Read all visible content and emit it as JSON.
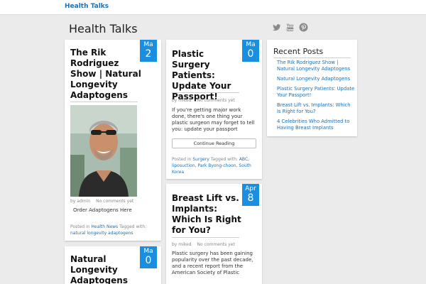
{
  "topbar": {
    "brand": "Health Talks"
  },
  "site": {
    "title": "Health Talks"
  },
  "social": {
    "icons": [
      "twitter-icon",
      "youtube-icon",
      "pinterest-icon"
    ],
    "color": "#8a8a8a"
  },
  "accent": "#1a8fe0",
  "posts": [
    {
      "date_month": "Ma",
      "date_day": "2",
      "title": "The Rik Rodriguez Show | Natural Longevity Adaptogens",
      "author": "by admin",
      "comments": "No comments yet",
      "excerpt": "Order Adaptogens Here",
      "posted_in_label": "Posted in",
      "category": "Health News",
      "tagged_label": "Tagged with:",
      "tags": "natural longevity adaptogens"
    },
    {
      "date_month": "Ma",
      "date_day": "0",
      "title": "Plastic Surgery Patients: Update Your Passport!",
      "author": "by miked",
      "comments": "No comments yet",
      "excerpt": "If you're getting major work done, there's one thing your plastic surgeon may forget to tell you: update your passport",
      "button": "Continue Reading",
      "posted_in_label": "Posted in",
      "category": "Surgery",
      "tagged_label": "Tagged with:",
      "tags": "ABC, liposuction, Park Byong-choon, South Korea"
    },
    {
      "date_month": "Apr",
      "date_day": "8",
      "title": "Breast Lift vs. Implants: Which Is Right for You?",
      "author": "by miked",
      "comments": "No comments yet",
      "excerpt": "Plastic surgery has been gaining popularity over the past decade, and a recent report from the American Society of Plastic"
    },
    {
      "date_month": "Ma",
      "date_day": "0",
      "title": "Natural Longevity Adaptogens"
    }
  ],
  "sidebar": {
    "title": "Recent Posts",
    "items": [
      "The Rik Rodriguez Show | Natural Longevity Adaptogens",
      "Natural Longevity Adaptogens",
      "Plastic Surgery Patients: Update Your Passport!",
      "Breast Lift vs. Implants: Which Is Right for You?",
      "4 Celebrities Who Admitted to Having Breast Implants"
    ]
  }
}
